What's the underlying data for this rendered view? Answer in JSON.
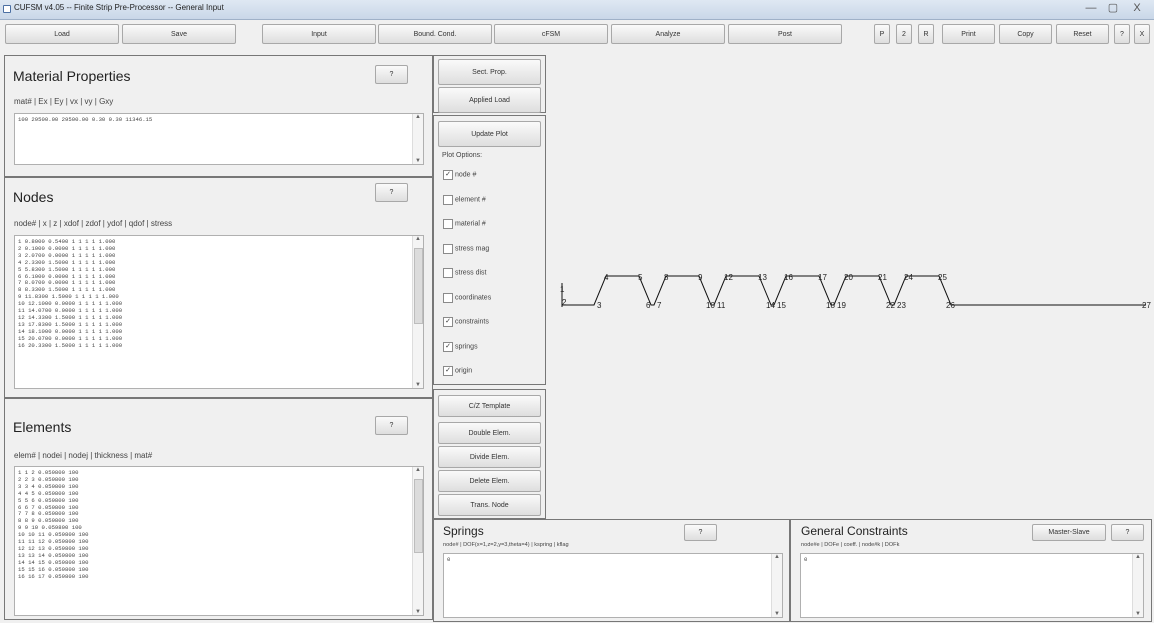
{
  "window": {
    "title": "CUFSM v4.05 -- Finite Strip Pre-Processor -- General Input",
    "minimize": "—",
    "maximize": "▢",
    "close": "X"
  },
  "toolbar": {
    "load": "Load",
    "save": "Save",
    "input": "Input",
    "bound_cond": "Bound. Cond.",
    "cfsm": "cFSM",
    "analyze": "Analyze",
    "post": "Post",
    "p": "P",
    "two": "2",
    "r": "R",
    "print": "Print",
    "copy": "Copy",
    "reset": "Reset",
    "help": "?",
    "exit": "X"
  },
  "material": {
    "title": "Material Properties",
    "help": "?",
    "header": "mat# | Ex | Ey | vx | vy | Gxy",
    "lines": [
      "100 29500.00 29500.00 0.30 0.30 11346.15"
    ]
  },
  "nodes": {
    "title": "Nodes",
    "help": "?",
    "header": "node# | x | z | xdof | zdof | ydof | qdof | stress",
    "lines": [
      "1 0.8000 0.5400 1 1 1 1 1.000",
      "2 0.1000 0.0000 1 1 1 1 1.000",
      "3 2.0700 0.0000 1 1 1 1 1.000",
      "4 2.3300 1.5000 1 1 1 1 1.000",
      "5 5.8300 1.5000 1 1 1 1 1.000",
      "6 6.1000 0.0000 1 1 1 1 1.000",
      "7 8.0700 0.0000 1 1 1 1 1.000",
      "8 8.3300 1.5000 1 1 1 1 1.000",
      "9 11.8300 1.5000 1 1 1 1 1.000",
      "10 12.1000 0.0000 1 1 1 1 1.000",
      "11 14.0700 0.0000 1 1 1 1 1.000",
      "12 14.3300 1.5000 1 1 1 1 1.000",
      "13 17.8300 1.5000 1 1 1 1 1.000",
      "14 18.1000 0.0000 1 1 1 1 1.000",
      "15 20.0700 0.0000 1 1 1 1 1.000",
      "16 20.3300 1.5000 1 1 1 1 1.000"
    ]
  },
  "elements": {
    "title": "Elements",
    "help": "?",
    "header": "elem# | nodei | nodej | thickness | mat#",
    "lines": [
      "1 1 2 0.059800 100",
      "2 2 3 0.059800 100",
      "3 3 4 0.059800 100",
      "4 4 5 0.059800 100",
      "5 5 6 0.059800 100",
      "6 6 7 0.059800 100",
      "7 7 8 0.059800 100",
      "8 8 9 0.059800 100",
      "9 9 10 0.059800 100",
      "10 10 11 0.059800 100",
      "11 11 12 0.059800 100",
      "12 12 13 0.059800 100",
      "13 13 14 0.059800 100",
      "14 14 15 0.059800 100",
      "15 15 16 0.059800 100",
      "16 16 17 0.059800 100"
    ]
  },
  "middle": {
    "sect_prop": "Sect. Prop.",
    "applied_load": "Applied Load",
    "update_plot": "Update Plot",
    "plot_options": "Plot Options:",
    "options": [
      {
        "label": "node #",
        "checked": true
      },
      {
        "label": "element #",
        "checked": false
      },
      {
        "label": "material #",
        "checked": false
      },
      {
        "label": "stress mag",
        "checked": false
      },
      {
        "label": "stress dist",
        "checked": false
      },
      {
        "label": "coordinates",
        "checked": false
      },
      {
        "label": "constraints",
        "checked": true
      },
      {
        "label": "springs",
        "checked": true
      },
      {
        "label": "origin",
        "checked": true
      }
    ],
    "cz_template": "C/Z Template",
    "double_elem": "Double Elem.",
    "divide_elem": "Divide Elem.",
    "delete_elem": "Delete Elem.",
    "trans_node": "Trans. Node"
  },
  "springs": {
    "title": "Springs",
    "help": "?",
    "header": "node# | DOF(x=1,z=2,y=3,theta=4) | kspring | kflag",
    "value": "0"
  },
  "constraints": {
    "title": "General Constraints",
    "master_slave": "Master-Slave",
    "help": "?",
    "header": "node#e | DOFe | coeff. | node#k | DOFk",
    "value": "0"
  },
  "plot": {
    "node_labels": [
      "1",
      "2",
      "3",
      "4",
      "5",
      "6",
      "7",
      "8",
      "9",
      "10",
      "11",
      "12",
      "13",
      "14",
      "15",
      "16",
      "17",
      "18",
      "19",
      "20",
      "21",
      "22",
      "23",
      "24",
      "25",
      "26",
      "27"
    ]
  }
}
